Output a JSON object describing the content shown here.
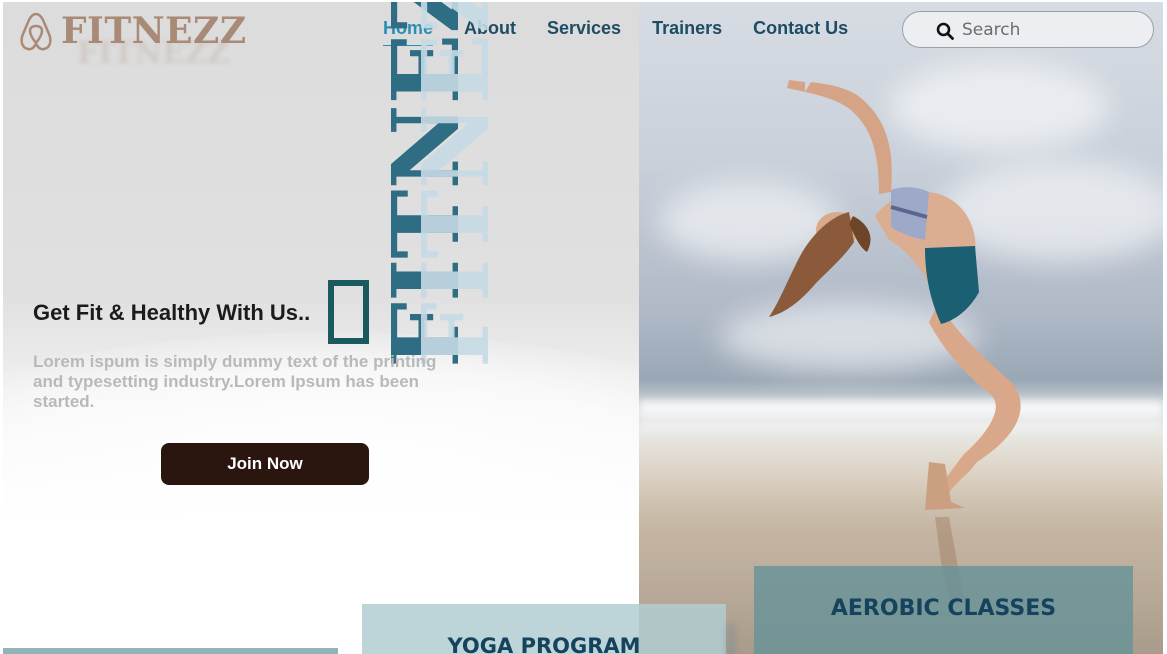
{
  "brand": {
    "name": "FITNEZZ",
    "vertical_wordmark": "FITNEZZ"
  },
  "nav": {
    "items": [
      {
        "label": "Home",
        "active": true
      },
      {
        "label": "About",
        "active": false
      },
      {
        "label": "Services",
        "active": false
      },
      {
        "label": "Trainers",
        "active": false
      },
      {
        "label": "Contact Us",
        "active": false
      }
    ]
  },
  "search": {
    "placeholder": "Search",
    "value": "",
    "icon": "search-icon"
  },
  "hero": {
    "headline": "Get Fit & Healthy With Us..",
    "glyph": "missing-glyph-box",
    "description": "Lorem ispum is simply dummy text of the printing and typesetting industry.Lorem Ipsum has been started.",
    "cta_label": "Join Now",
    "image": "woman-yoga-backbend-on-beach"
  },
  "programs": [
    {
      "title": "YOGA PROGRAM"
    },
    {
      "title": "AEROBIC CLASSES"
    },
    {
      "title": ""
    }
  ],
  "colors": {
    "logo": "#a98a76",
    "nav_text": "#1e4c63",
    "nav_active": "#2a8fb5",
    "cta_bg": "#2b150f",
    "wordmark_dark": "#2e6d84",
    "wordmark_light": "#c5d9e4",
    "card_text": "#15435e"
  }
}
